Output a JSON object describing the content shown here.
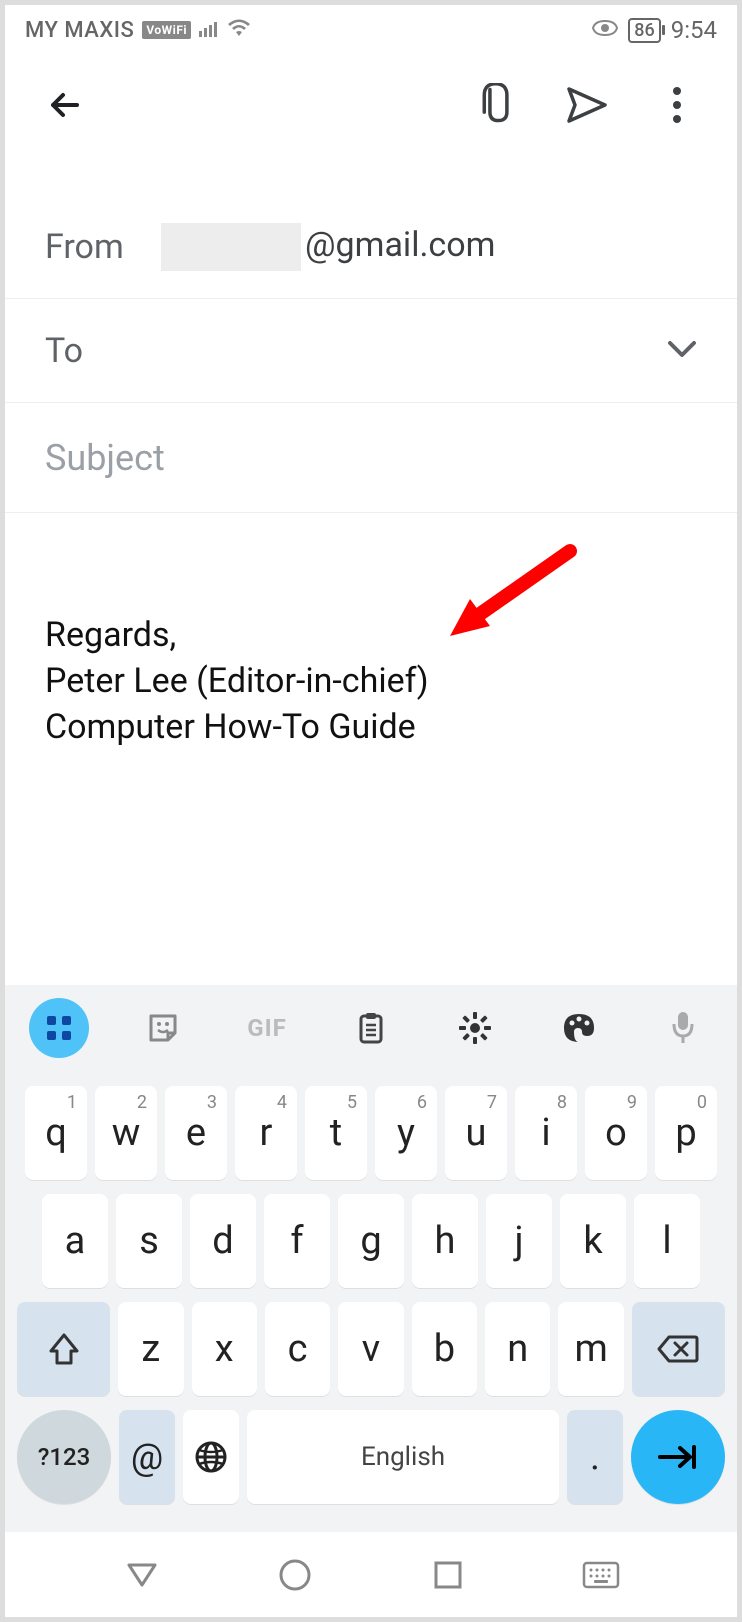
{
  "status": {
    "carrier": "MY MAXIS",
    "vowifi": "VoWiFi",
    "battery": "86",
    "time": "9:54"
  },
  "compose": {
    "from_label": "From",
    "from_domain": "@gmail.com",
    "to_label": "To",
    "subject_placeholder": "Subject",
    "body_line1": "Regards,",
    "body_line2": "Peter Lee (Editor-in-chief)",
    "body_line3": "Computer How-To Guide"
  },
  "keyboard": {
    "gif": "GIF",
    "row1": [
      {
        "k": "q",
        "n": "1"
      },
      {
        "k": "w",
        "n": "2"
      },
      {
        "k": "e",
        "n": "3"
      },
      {
        "k": "r",
        "n": "4"
      },
      {
        "k": "t",
        "n": "5"
      },
      {
        "k": "y",
        "n": "6"
      },
      {
        "k": "u",
        "n": "7"
      },
      {
        "k": "i",
        "n": "8"
      },
      {
        "k": "o",
        "n": "9"
      },
      {
        "k": "p",
        "n": "0"
      }
    ],
    "row2": [
      "a",
      "s",
      "d",
      "f",
      "g",
      "h",
      "j",
      "k",
      "l"
    ],
    "row3": [
      "z",
      "x",
      "c",
      "v",
      "b",
      "n",
      "m"
    ],
    "symbols": "?123",
    "at": "@",
    "space": "English",
    "dot": "."
  }
}
